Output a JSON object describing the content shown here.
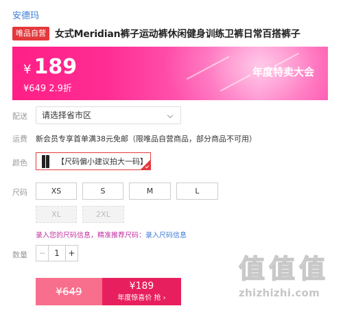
{
  "brand": "安德玛",
  "product": {
    "badge": "唯品自营",
    "title": "女式Meridian裤子运动裤休闲健身训练卫裤日常百搭裤子"
  },
  "banner": {
    "currency": "¥",
    "price": "189",
    "original": "¥649 2.9折",
    "tag": "年度特卖大会",
    "colors": {
      "start": "#ff1f86",
      "end": "#ff88cc"
    }
  },
  "delivery": {
    "label": "配送",
    "placeholder": "请选择省市区",
    "icon": "chevron-down-icon"
  },
  "shipping": {
    "label": "运费",
    "text": "新会员专享首单满38元免邮（限唯品自营商品，部分商品不可用）"
  },
  "color": {
    "label": "颜色",
    "option": "【尺码偏小建议拍大一码】",
    "selected": true,
    "accent": "#e4393c"
  },
  "size": {
    "label": "尺码",
    "options": [
      {
        "label": "XS",
        "available": true
      },
      {
        "label": "S",
        "available": true
      },
      {
        "label": "M",
        "available": true
      },
      {
        "label": "L",
        "available": true
      },
      {
        "label": "XL",
        "available": false
      },
      {
        "label": "2XL",
        "available": false
      }
    ],
    "tip_warn": "录入您的尺码信息，精准推荐尺码：",
    "tip_link": "录入尺码信息"
  },
  "quantity": {
    "label": "数量",
    "value": "1",
    "minus": "−",
    "plus": "+"
  },
  "buy": {
    "original": "¥649",
    "price": "¥189",
    "sub": "年度惊喜价 抢 ›",
    "colors": {
      "left": "#f76f8c",
      "right": "#e81f5e"
    }
  },
  "watermark": {
    "glyphs": [
      "值",
      "值",
      "值"
    ],
    "url": "zhizhizhi.com"
  }
}
